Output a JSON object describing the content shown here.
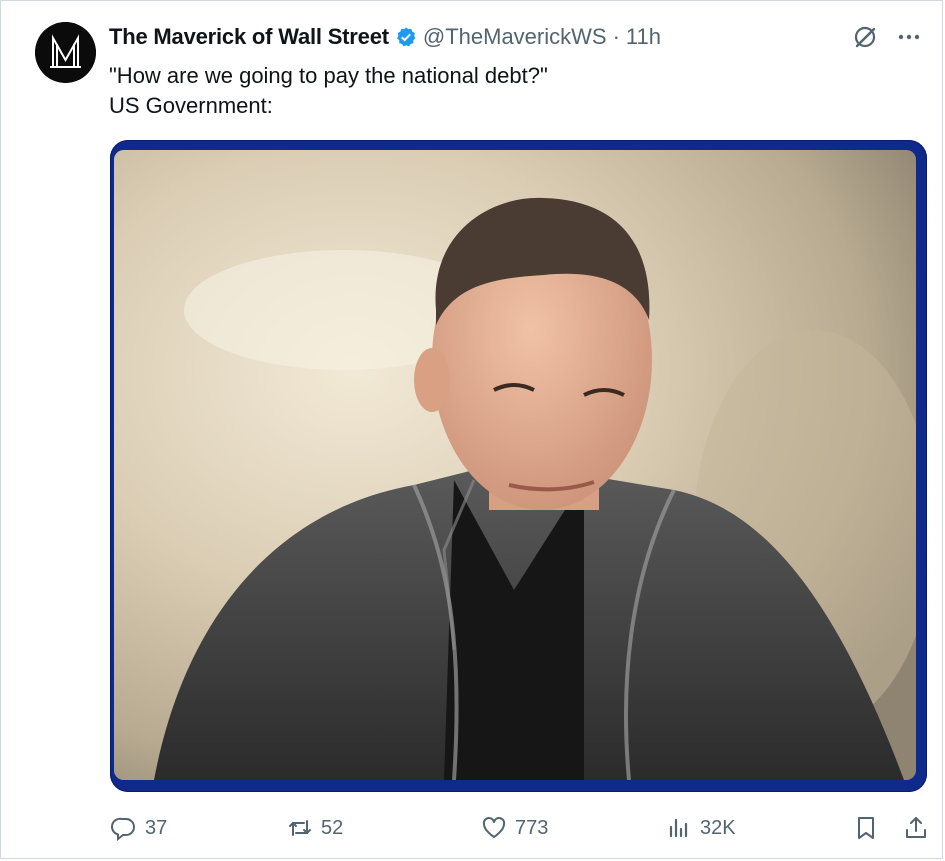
{
  "post": {
    "author_name": "The Maverick of Wall Street",
    "handle": "@TheMaverickWS",
    "separator": "·",
    "time": "11h",
    "text_lines": [
      "\"How are we going to pay the national debt?\"",
      "US Government:"
    ],
    "avatar_letter": "M",
    "media_description_alt": ""
  },
  "actions": {
    "replies": "37",
    "reposts": "52",
    "likes": "773",
    "views": "32K"
  },
  "icons": {
    "verified": "verified-badge-icon",
    "grok": "grok-icon",
    "more": "more-icon",
    "reply": "reply-icon",
    "repost": "repost-icon",
    "like": "heart-icon",
    "views": "views-icon",
    "bookmark": "bookmark-icon",
    "share": "share-icon"
  },
  "colors": {
    "verified": "#1d9bf0",
    "muted": "#536471",
    "text": "#0f1419",
    "media_frame": "#0f2a8a"
  }
}
